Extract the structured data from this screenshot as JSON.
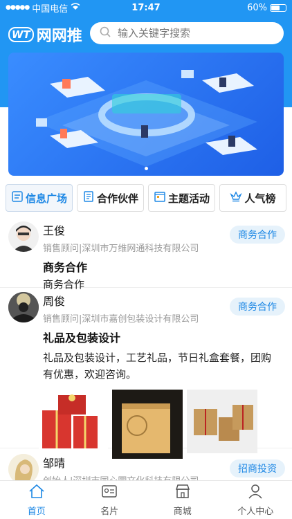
{
  "status_bar": {
    "carrier": "中国电信",
    "time": "17:47",
    "battery": "60%",
    "battery_level": 0.6
  },
  "header": {
    "logo_text": "网网推",
    "logo_mark": "WT",
    "search_placeholder": "输入关键字搜索"
  },
  "tabs": [
    {
      "label": "信息广场",
      "icon": "info-square-icon",
      "active": true
    },
    {
      "label": "合作伙伴",
      "icon": "partner-icon",
      "active": false
    },
    {
      "label": "主题活动",
      "icon": "calendar-icon",
      "active": false
    },
    {
      "label": "人气榜",
      "icon": "crown-icon",
      "active": false
    }
  ],
  "posts": [
    {
      "name": "王俊",
      "meta": "销售顾问|深圳市万维网通科技有限公司",
      "tag": "商务合作",
      "title": "商务合作",
      "body": "商务合作"
    },
    {
      "name": "周俊",
      "meta": "销售顾问|深圳市嘉创包装设计有限公司",
      "tag": "商务合作",
      "title": "礼品及包装设计",
      "body": "礼品及包装设计，工艺礼品，节日礼盒套餐，团购有优惠，欢迎咨询。"
    },
    {
      "name": "邹晴",
      "meta": "创始人|深圳市同心圆文化科技有限公司",
      "tag": "招商投资"
    }
  ],
  "nav": [
    {
      "label": "首页",
      "icon": "home-icon",
      "active": true
    },
    {
      "label": "名片",
      "icon": "card-icon",
      "active": false
    },
    {
      "label": "商城",
      "icon": "shop-icon",
      "active": false
    },
    {
      "label": "个人中心",
      "icon": "user-icon",
      "active": false
    }
  ],
  "colors": {
    "primary": "#2196f3",
    "accent": "#1e88e5"
  }
}
